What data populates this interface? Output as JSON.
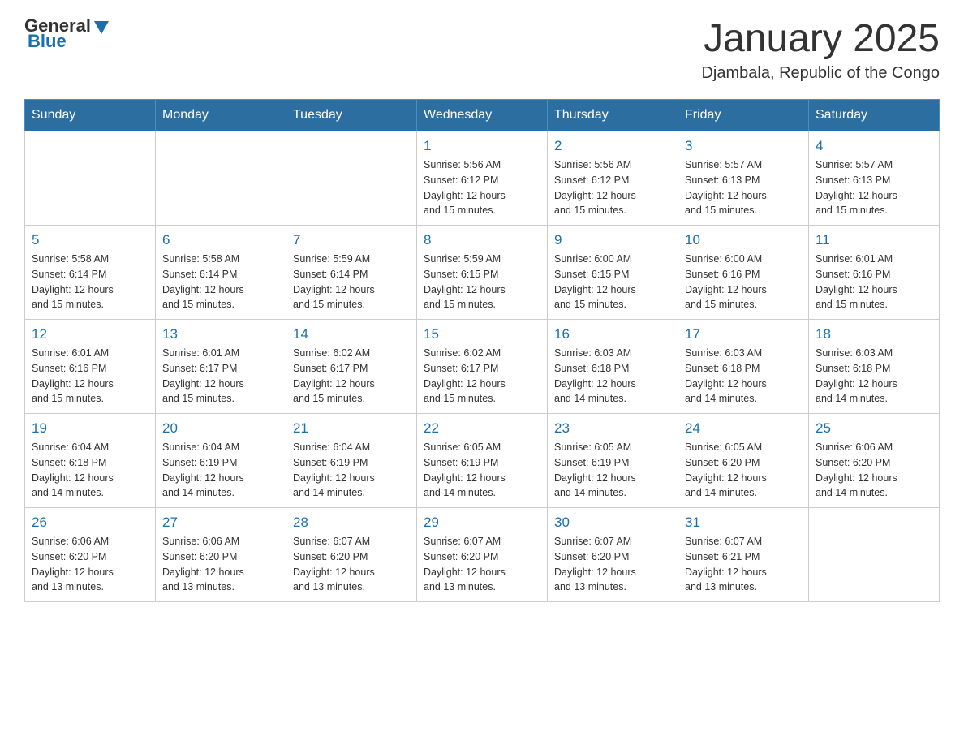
{
  "header": {
    "logo": {
      "general": "General",
      "blue": "Blue"
    },
    "month_title": "January 2025",
    "location": "Djambala, Republic of the Congo"
  },
  "weekdays": [
    "Sunday",
    "Monday",
    "Tuesday",
    "Wednesday",
    "Thursday",
    "Friday",
    "Saturday"
  ],
  "weeks": [
    [
      {
        "day": "",
        "info": ""
      },
      {
        "day": "",
        "info": ""
      },
      {
        "day": "",
        "info": ""
      },
      {
        "day": "1",
        "info": "Sunrise: 5:56 AM\nSunset: 6:12 PM\nDaylight: 12 hours\nand 15 minutes."
      },
      {
        "day": "2",
        "info": "Sunrise: 5:56 AM\nSunset: 6:12 PM\nDaylight: 12 hours\nand 15 minutes."
      },
      {
        "day": "3",
        "info": "Sunrise: 5:57 AM\nSunset: 6:13 PM\nDaylight: 12 hours\nand 15 minutes."
      },
      {
        "day": "4",
        "info": "Sunrise: 5:57 AM\nSunset: 6:13 PM\nDaylight: 12 hours\nand 15 minutes."
      }
    ],
    [
      {
        "day": "5",
        "info": "Sunrise: 5:58 AM\nSunset: 6:14 PM\nDaylight: 12 hours\nand 15 minutes."
      },
      {
        "day": "6",
        "info": "Sunrise: 5:58 AM\nSunset: 6:14 PM\nDaylight: 12 hours\nand 15 minutes."
      },
      {
        "day": "7",
        "info": "Sunrise: 5:59 AM\nSunset: 6:14 PM\nDaylight: 12 hours\nand 15 minutes."
      },
      {
        "day": "8",
        "info": "Sunrise: 5:59 AM\nSunset: 6:15 PM\nDaylight: 12 hours\nand 15 minutes."
      },
      {
        "day": "9",
        "info": "Sunrise: 6:00 AM\nSunset: 6:15 PM\nDaylight: 12 hours\nand 15 minutes."
      },
      {
        "day": "10",
        "info": "Sunrise: 6:00 AM\nSunset: 6:16 PM\nDaylight: 12 hours\nand 15 minutes."
      },
      {
        "day": "11",
        "info": "Sunrise: 6:01 AM\nSunset: 6:16 PM\nDaylight: 12 hours\nand 15 minutes."
      }
    ],
    [
      {
        "day": "12",
        "info": "Sunrise: 6:01 AM\nSunset: 6:16 PM\nDaylight: 12 hours\nand 15 minutes."
      },
      {
        "day": "13",
        "info": "Sunrise: 6:01 AM\nSunset: 6:17 PM\nDaylight: 12 hours\nand 15 minutes."
      },
      {
        "day": "14",
        "info": "Sunrise: 6:02 AM\nSunset: 6:17 PM\nDaylight: 12 hours\nand 15 minutes."
      },
      {
        "day": "15",
        "info": "Sunrise: 6:02 AM\nSunset: 6:17 PM\nDaylight: 12 hours\nand 15 minutes."
      },
      {
        "day": "16",
        "info": "Sunrise: 6:03 AM\nSunset: 6:18 PM\nDaylight: 12 hours\nand 14 minutes."
      },
      {
        "day": "17",
        "info": "Sunrise: 6:03 AM\nSunset: 6:18 PM\nDaylight: 12 hours\nand 14 minutes."
      },
      {
        "day": "18",
        "info": "Sunrise: 6:03 AM\nSunset: 6:18 PM\nDaylight: 12 hours\nand 14 minutes."
      }
    ],
    [
      {
        "day": "19",
        "info": "Sunrise: 6:04 AM\nSunset: 6:18 PM\nDaylight: 12 hours\nand 14 minutes."
      },
      {
        "day": "20",
        "info": "Sunrise: 6:04 AM\nSunset: 6:19 PM\nDaylight: 12 hours\nand 14 minutes."
      },
      {
        "day": "21",
        "info": "Sunrise: 6:04 AM\nSunset: 6:19 PM\nDaylight: 12 hours\nand 14 minutes."
      },
      {
        "day": "22",
        "info": "Sunrise: 6:05 AM\nSunset: 6:19 PM\nDaylight: 12 hours\nand 14 minutes."
      },
      {
        "day": "23",
        "info": "Sunrise: 6:05 AM\nSunset: 6:19 PM\nDaylight: 12 hours\nand 14 minutes."
      },
      {
        "day": "24",
        "info": "Sunrise: 6:05 AM\nSunset: 6:20 PM\nDaylight: 12 hours\nand 14 minutes."
      },
      {
        "day": "25",
        "info": "Sunrise: 6:06 AM\nSunset: 6:20 PM\nDaylight: 12 hours\nand 14 minutes."
      }
    ],
    [
      {
        "day": "26",
        "info": "Sunrise: 6:06 AM\nSunset: 6:20 PM\nDaylight: 12 hours\nand 13 minutes."
      },
      {
        "day": "27",
        "info": "Sunrise: 6:06 AM\nSunset: 6:20 PM\nDaylight: 12 hours\nand 13 minutes."
      },
      {
        "day": "28",
        "info": "Sunrise: 6:07 AM\nSunset: 6:20 PM\nDaylight: 12 hours\nand 13 minutes."
      },
      {
        "day": "29",
        "info": "Sunrise: 6:07 AM\nSunset: 6:20 PM\nDaylight: 12 hours\nand 13 minutes."
      },
      {
        "day": "30",
        "info": "Sunrise: 6:07 AM\nSunset: 6:20 PM\nDaylight: 12 hours\nand 13 minutes."
      },
      {
        "day": "31",
        "info": "Sunrise: 6:07 AM\nSunset: 6:21 PM\nDaylight: 12 hours\nand 13 minutes."
      },
      {
        "day": "",
        "info": ""
      }
    ]
  ]
}
